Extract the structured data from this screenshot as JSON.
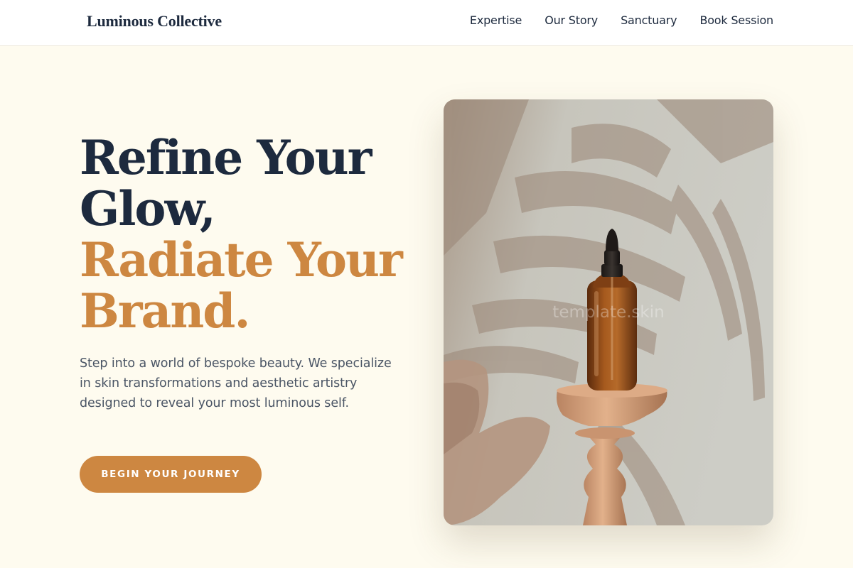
{
  "header": {
    "brand": "Luminous Collective",
    "nav": [
      {
        "label": "Expertise"
      },
      {
        "label": "Our Story"
      },
      {
        "label": "Sanctuary"
      },
      {
        "label": "Book Session"
      }
    ]
  },
  "hero": {
    "headline_line1": "Refine Your",
    "headline_line2": "Glow,",
    "headline_line3": "Radiate Your",
    "headline_line4": "Brand.",
    "description": "Step into a world of bespoke beauty. We specialize in skin transformations and aesthetic artistry designed to reveal your most luminous self.",
    "cta_label": "BEGIN YOUR JOURNEY"
  },
  "image": {
    "watermark": "template.skin"
  },
  "colors": {
    "background": "#FEFBEF",
    "navy": "#1D2A3E",
    "accent": "#CD8741",
    "body_text": "#4A5565"
  }
}
